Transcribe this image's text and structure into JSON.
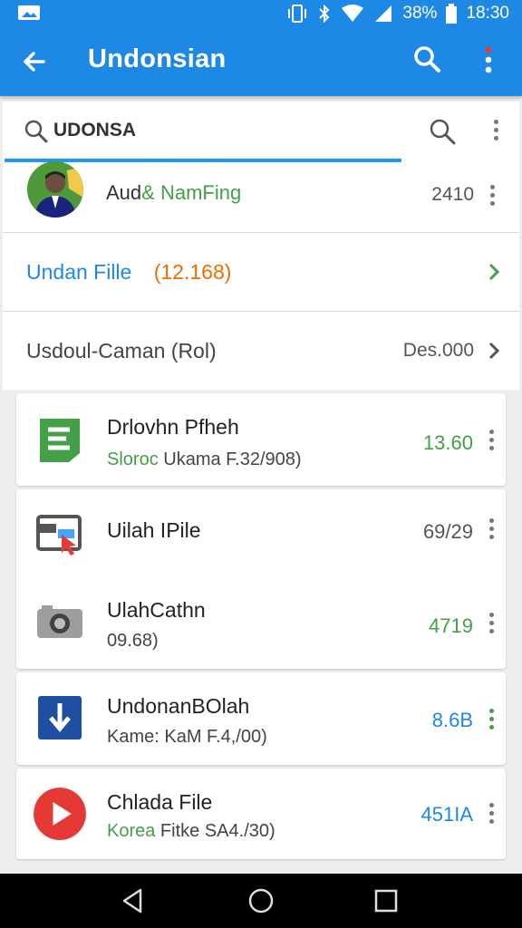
{
  "status_bar": {
    "battery": "38%",
    "time": "18:30"
  },
  "app_bar": {
    "title": "Undonsian"
  },
  "search": {
    "query": "UDONSA"
  },
  "top_list": [
    {
      "name_part1": "Aud",
      "name_part2": "& NamFing",
      "value": "2410"
    },
    {
      "label": "Undan Fille",
      "count": "(12.168)"
    },
    {
      "label": "Usdoul-Caman (Rol)",
      "value": "Des.000"
    }
  ],
  "items": [
    {
      "title": "Drlovhn Pfheh",
      "sub_accent": "Sloroc",
      "sub_rest": " Ukama F.32/908)",
      "value": "13.60",
      "value_color": "#43a047",
      "icon": "green-doc-icon"
    },
    {
      "title": "Uilah IPile",
      "sub_accent": "",
      "sub_rest": "",
      "value": "69/29",
      "value_color": "#555555",
      "icon": "image-file-icon"
    },
    {
      "title": "UlahCathn",
      "sub_accent": "",
      "sub_rest": "09.68)",
      "value": "4719",
      "value_color": "#43a047",
      "icon": "camera-icon"
    },
    {
      "title": "UndonanBOlah",
      "sub_accent": "",
      "sub_rest": "Kame: KaM F.4,/00)",
      "value": "8.6B",
      "value_color": "#1e88e5",
      "icon": "download-icon"
    },
    {
      "title": "Chlada File",
      "sub_accent": "Korea",
      "sub_rest": " Fitke SA4./30)",
      "value": "451IA",
      "value_color": "#1e88e5",
      "icon": "play-icon"
    }
  ],
  "colors": {
    "primary": "#1e88e5",
    "accent_green": "#43a047",
    "count_orange": "#ef6c00"
  }
}
